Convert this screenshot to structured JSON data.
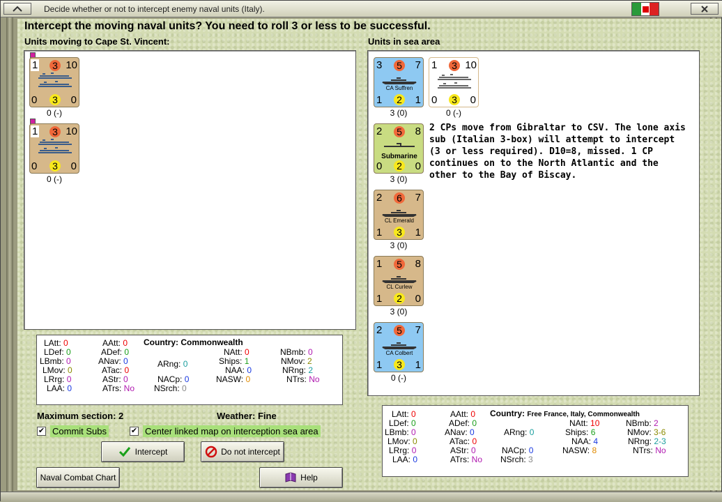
{
  "window": {
    "title": "Decide whether or not to intercept enemy naval units (Italy)."
  },
  "heading": "Intercept the moving naval units?  You need to roll 3 or less to be successful.",
  "left_label": "Units moving to Cape St. Vincent:",
  "right_label": "Units in sea area",
  "moving_units": [
    {
      "top": "1",
      "atk": "3",
      "rng": "10",
      "bl": "0",
      "circ": "3",
      "br": "0",
      "under": "0 (-)"
    },
    {
      "top": "1",
      "atk": "3",
      "rng": "10",
      "bl": "0",
      "circ": "3",
      "br": "0",
      "under": "0 (-)"
    }
  ],
  "sea_units": [
    {
      "tl": "3",
      "atk": "5",
      "tr": "7",
      "name": "CA Suffren",
      "bl": "1",
      "circ": "2",
      "br": "1",
      "under": "3 (0)"
    },
    {
      "tl": "1",
      "atk": "3",
      "tr": "10",
      "name": "",
      "bl": "0",
      "circ": "3",
      "br": "0",
      "under": "0 (-)"
    },
    {
      "tl": "2",
      "atk": "5",
      "tr": "8",
      "name": "Submarine",
      "bl": "0",
      "circ": "2",
      "br": "0",
      "under": "3 (0)"
    },
    {
      "tl": "2",
      "atk": "6",
      "tr": "7",
      "name": "CL Emerald",
      "bl": "1",
      "circ": "3",
      "br": "1",
      "under": "3 (0)"
    },
    {
      "tl": "1",
      "atk": "5",
      "tr": "8",
      "name": "CL Curlew",
      "bl": "1",
      "circ": "2",
      "br": "0",
      "under": "3 (0)"
    },
    {
      "tl": "2",
      "atk": "5",
      "tr": "7",
      "name": "CA Colbert",
      "bl": "1",
      "circ": "3",
      "br": "1",
      "under": "0 (-)"
    }
  ],
  "note": "2 CPs move from Gibraltar to CSV.  The lone axis sub (Italian 3-box) will attempt to intercept (3 or less required).  D10=8, missed.  1 CP continues on to the North Atlantic and the other to the Bay of Biscay.",
  "left_stats": {
    "country_label": "Country:",
    "country": "Commonwealth",
    "LAtt": "0",
    "LDef": "0",
    "LBmb": "0",
    "LMov": "0",
    "LRrg": "0",
    "LAA": "0",
    "AAtt": "0",
    "ADef": "0",
    "ANav": "0",
    "ATac": "0",
    "AStr": "0",
    "ATrs": "No",
    "ARng": "0",
    "NACp": "0",
    "NSrch": "0",
    "NAtt": "0",
    "Ships": "1",
    "NAA": "0",
    "NASW": "0",
    "NBmb": "0",
    "NMov": "2",
    "NRng": "2",
    "NTrs": "No"
  },
  "right_stats": {
    "country_label": "Country:",
    "country": "Free France, Italy, Commonwealth",
    "LAtt": "0",
    "LDef": "0",
    "LBmb": "0",
    "LMov": "0",
    "LRrg": "0",
    "LAA": "0",
    "AAtt": "0",
    "ADef": "0",
    "ANav": "0",
    "ATac": "0",
    "AStr": "0",
    "ATrs": "No",
    "ARng": "0",
    "NACp": "0",
    "NSrch": "3",
    "NAtt": "10",
    "Ships": "6",
    "NAA": "4",
    "NASW": "8",
    "NBmb": "2",
    "NMov": "3-6",
    "NRng": "2-3",
    "NTrs": "No"
  },
  "max_section": "Maximum section: 2",
  "weather": "Weather:  Fine",
  "commit_subs": "Commit Subs",
  "center_map": "Center linked map on interception sea area",
  "buttons": {
    "intercept": "Intercept",
    "no_intercept": "Do not intercept",
    "chart": "Naval Combat Chart",
    "help": "Help"
  }
}
